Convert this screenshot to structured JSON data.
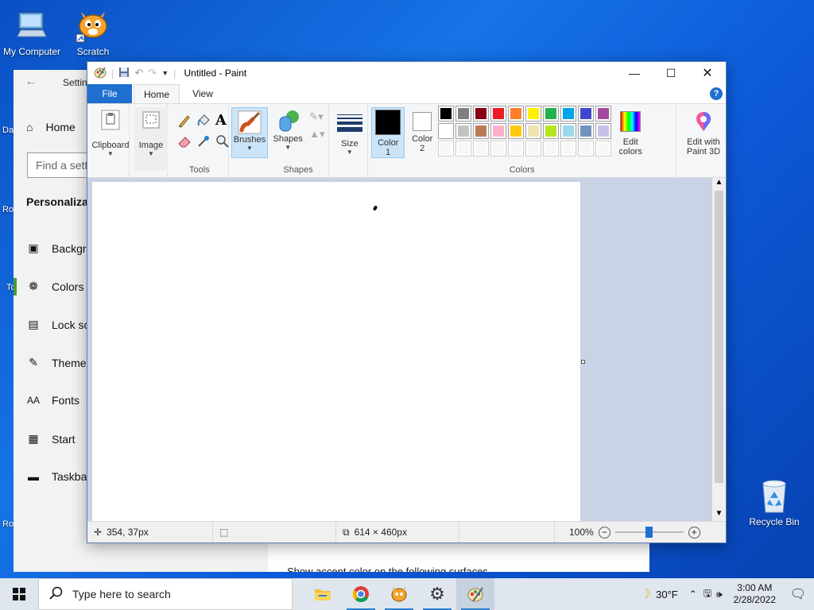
{
  "desktop": {
    "icons": [
      {
        "label": "My Computer"
      },
      {
        "label": "Scratch"
      },
      {
        "label": "Recycle Bin"
      }
    ],
    "edge_labels": [
      "Da",
      "Ro",
      "Tc",
      "Ro"
    ]
  },
  "settings": {
    "title": "Settin",
    "home_label": "Home",
    "search_placeholder": "Find a setti",
    "section": "Personalizat",
    "nav": [
      {
        "label": "Backgro",
        "icon": "picture-icon"
      },
      {
        "label": "Colors",
        "icon": "palette-icon"
      },
      {
        "label": "Lock sc",
        "icon": "lock-screen-icon"
      },
      {
        "label": "Themes",
        "icon": "themes-icon"
      },
      {
        "label": "Fonts",
        "icon": "fonts-icon"
      },
      {
        "label": "Start",
        "icon": "start-icon"
      },
      {
        "label": "Taskbar",
        "icon": "taskbar-icon"
      }
    ],
    "bottom_text": "Show accent color on the following surfaces"
  },
  "paint": {
    "title": "Untitled - Paint",
    "tabs": {
      "file": "File",
      "home": "Home",
      "view": "View"
    },
    "help": "?",
    "clipboard": {
      "label": "Clipboard"
    },
    "image": {
      "label": "Image"
    },
    "tools": {
      "group_label": "Tools",
      "text_tool": "A"
    },
    "brushes": {
      "label": "Brushes"
    },
    "shapes": {
      "label": "Shapes",
      "group_label": "Shapes"
    },
    "size": {
      "label": "Size"
    },
    "color1": {
      "label_line1": "Color",
      "label_line2": "1",
      "value": "#000000"
    },
    "color2": {
      "label_line1": "Color",
      "label_line2": "2",
      "value": "#ffffff"
    },
    "colors_group_label": "Colors",
    "edit_colors": {
      "line1": "Edit",
      "line2": "colors"
    },
    "paint3d": {
      "line1": "Edit with",
      "line2": "Paint 3D"
    },
    "palette_row1": [
      "#000000",
      "#7f7f7f",
      "#880015",
      "#ed1c24",
      "#ff7f27",
      "#fff200",
      "#22b14c",
      "#00a2e8",
      "#3f48cc",
      "#a349a4"
    ],
    "palette_row2": [
      "#ffffff",
      "#c3c3c3",
      "#b97a57",
      "#ffaec9",
      "#ffc90e",
      "#efe4b0",
      "#b5e61d",
      "#99d9ea",
      "#7092be",
      "#c8bfe7"
    ],
    "status": {
      "cursor_pos": "354, 37px",
      "canvas_size": "614 × 460px",
      "zoom": "100%",
      "zoom_fraction": 0.5
    }
  },
  "taskbar": {
    "search_placeholder": "Type here to search",
    "temperature": "30°F",
    "time": "3:00 AM",
    "date": "2/28/2022"
  }
}
